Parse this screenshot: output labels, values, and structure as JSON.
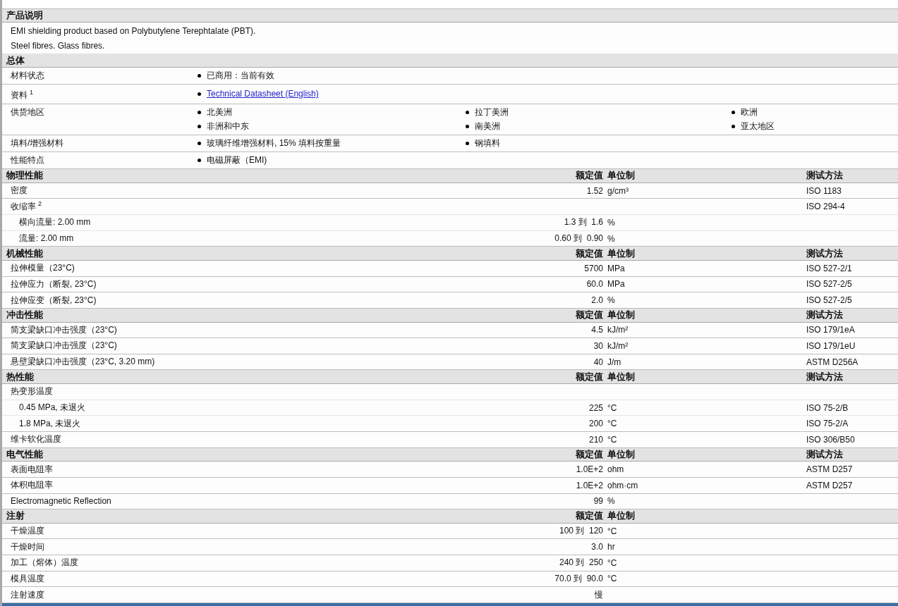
{
  "sections": [
    {
      "title": "产品说明",
      "kind": "text",
      "lines": [
        "EMI shielding product based on Polybutylene Terephtalate (PBT).",
        "Steel fibres. Glass fibres."
      ]
    },
    {
      "title": "总体",
      "kind": "overview",
      "rows": [
        {
          "label": "材料状态",
          "items": [
            {
              "text": "已商用：当前有效",
              "kind": "text"
            }
          ]
        },
        {
          "label": "资料",
          "note": "1",
          "items": [
            {
              "text": "Technical Datasheet (English)",
              "kind": "link"
            }
          ]
        },
        {
          "label": "供货地区",
          "items": [
            {
              "text": "北美洲",
              "kind": "text"
            },
            {
              "text": "拉丁美洲",
              "kind": "text"
            },
            {
              "text": "欧洲",
              "kind": "text"
            },
            {
              "text": "非洲和中东",
              "kind": "text"
            },
            {
              "text": "南美洲",
              "kind": "text"
            },
            {
              "text": "亚太地区",
              "kind": "text"
            }
          ]
        },
        {
          "label": "填料/增强材料",
          "items": [
            {
              "text": "玻璃纤维增强材料, 15% 填料按重量",
              "kind": "text"
            },
            {
              "text": "钢填料",
              "kind": "text"
            }
          ]
        },
        {
          "label": "性能特点",
          "items": [
            {
              "text": "电磁屏蔽（EMI)",
              "kind": "text"
            }
          ]
        }
      ]
    },
    {
      "title": "物理性能",
      "kind": "properties",
      "columns": [
        "额定值",
        "单位制",
        "测试方法"
      ],
      "rows": [
        {
          "label": "密度",
          "value": "1.52",
          "unit": "g/cm³",
          "method": "ISO 1183"
        },
        {
          "label": "收缩率",
          "note": "2",
          "method": "ISO 294-4",
          "children": [
            {
              "label": "横向流量: 2.00 mm",
              "value": "1.3 到  1.6",
              "unit": "%"
            },
            {
              "label": "流量: 2.00 mm",
              "value": "0.60 到  0.90",
              "unit": "%"
            }
          ]
        }
      ]
    },
    {
      "title": "机械性能",
      "kind": "properties",
      "columns": [
        "额定值",
        "单位制",
        "测试方法"
      ],
      "rows": [
        {
          "label": "拉伸模量（23°C)",
          "value": "5700",
          "unit": "MPa",
          "method": "ISO 527-2/1"
        },
        {
          "label": "拉伸应力（断裂, 23°C)",
          "value": "60.0",
          "unit": "MPa",
          "method": "ISO 527-2/5"
        },
        {
          "label": "拉伸应变（断裂, 23°C)",
          "value": "2.0",
          "unit": "%",
          "method": "ISO 527-2/5"
        }
      ]
    },
    {
      "title": "冲击性能",
      "kind": "properties",
      "columns": [
        "额定值",
        "单位制",
        "测试方法"
      ],
      "rows": [
        {
          "label": "简支梁缺口冲击强度（23°C)",
          "value": "4.5",
          "unit": "kJ/m²",
          "method": "ISO 179/1eA"
        },
        {
          "label": "简支梁缺口冲击强度（23°C)",
          "value": "30",
          "unit": "kJ/m²",
          "method": "ISO 179/1eU"
        },
        {
          "label": "悬壁梁缺口冲击强度（23°C, 3.20 mm)",
          "value": "40",
          "unit": "J/m",
          "method": "ASTM D256A"
        }
      ]
    },
    {
      "title": "热性能",
      "kind": "properties",
      "columns": [
        "额定值",
        "单位制",
        "测试方法"
      ],
      "rows": [
        {
          "label": "热变形温度",
          "children": [
            {
              "label": "0.45 MPa, 未退火",
              "value": "225",
              "unit": "°C",
              "method": "ISO 75-2/B"
            },
            {
              "label": "1.8 MPa, 未退火",
              "value": "200",
              "unit": "°C",
              "method": "ISO 75-2/A"
            }
          ]
        },
        {
          "label": "维卡软化温度",
          "value": "210",
          "unit": "°C",
          "method": "ISO 306/B50"
        }
      ]
    },
    {
      "title": "电气性能",
      "kind": "properties",
      "columns": [
        "额定值",
        "单位制",
        "测试方法"
      ],
      "rows": [
        {
          "label": "表面电阻率",
          "value": "1.0E+2",
          "unit": "ohm",
          "method": "ASTM D257"
        },
        {
          "label": "体积电阻率",
          "value": "1.0E+2",
          "unit": "ohm·cm",
          "method": "ASTM D257"
        },
        {
          "label": "Electromagnetic Reflection",
          "value": "99",
          "unit": "%"
        }
      ]
    },
    {
      "title": "注射",
      "kind": "properties",
      "columns": [
        "额定值",
        "单位制"
      ],
      "rows": [
        {
          "label": "干燥温度",
          "value": "100 到  120",
          "unit": "°C"
        },
        {
          "label": "干燥时间",
          "value": "3.0",
          "unit": "hr"
        },
        {
          "label": "加工（熔体）温度",
          "value": "240 到  250",
          "unit": "°C"
        },
        {
          "label": "模具温度",
          "value": "70.0 到  90.0",
          "unit": "°C"
        },
        {
          "label": "注射速度",
          "value": "慢"
        }
      ]
    }
  ]
}
